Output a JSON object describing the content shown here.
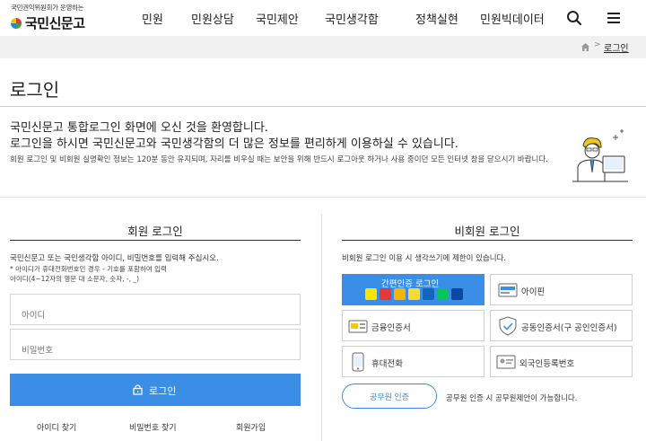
{
  "header": {
    "logo_sub": "국민권익위원회가 운영하는",
    "logo_main": "국민신문고",
    "nav": [
      "민원",
      "민원상담",
      "국민제안",
      "국민생각함",
      "정책실현",
      "민원빅데이터"
    ],
    "search_icon": "search-icon",
    "menu_icon": "hamburger-icon"
  },
  "breadcrumb": {
    "home_icon": "home-icon",
    "separator": ">",
    "current": "로그인"
  },
  "page_title": "로그인",
  "welcome": {
    "line1": "국민신문고 통합로그인 화면에 오신 것을 환영합니다.",
    "line2": "로그인을 하시면 국민신문고와 국민생각함의 더 많은 정보를 편리하게 이용하실 수 있습니다.",
    "note": "회원 로그인 및 비회원 실명확인 정보는 120분 동안 유지되며, 자리를 비우실 때는 보안을 위해 반드시 로그아웃 하거나 사용 중이던 모든 인터넷 창을 닫으시기 바랍니다."
  },
  "member": {
    "title": "회원 로그인",
    "desc": "국민신문고 또는 국민생각함 아이디, 비밀번호를 입력해 주십시오.",
    "note1": "* 아이디가 휴대전화번호인 경우 - 기호를 포함하여 입력",
    "note2": "아이디(4~12자의 영문 대 소문자, 숫자, -, _)",
    "id_placeholder": "아이디",
    "pw_placeholder": "비밀번호",
    "login_label": "로그인",
    "links": [
      "아이디 찾기",
      "비밀번호 찾기",
      "회원가입"
    ]
  },
  "nonmember": {
    "title": "비회원 로그인",
    "desc": "비회원 로그인 이용 시 생각쓰기에 제한이 있습니다.",
    "easy_auth": "간편인증 로그인",
    "options": [
      "아이핀",
      "금융인증서",
      "공동인증서(구 공인인증서)",
      "휴대전화",
      "외국인등록번호"
    ],
    "gov_button": "공무원 인증",
    "gov_desc": "공무원 인증 시 공무원제안이 가능합니다."
  },
  "colors": {
    "accent": "#3a8ee6",
    "crumb_bg": "#f1f1f1"
  }
}
